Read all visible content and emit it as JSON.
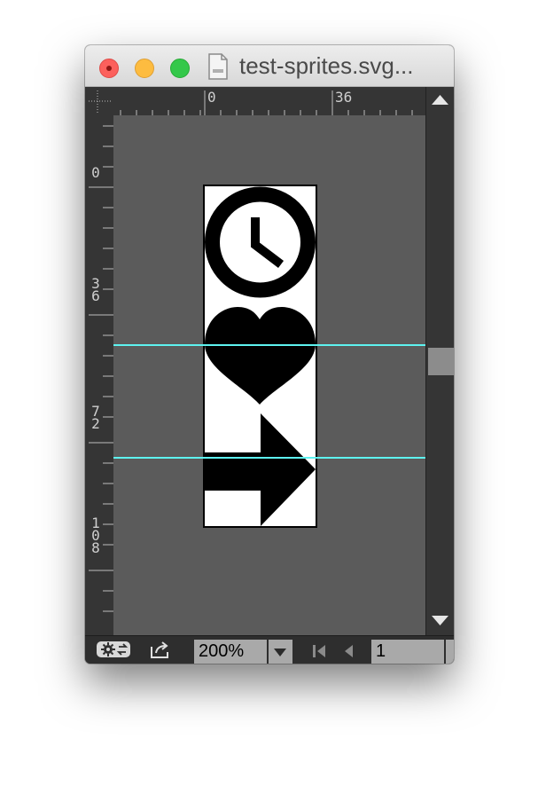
{
  "window": {
    "title": "test-sprites.svg..."
  },
  "rulers": {
    "top_labels": [
      "0",
      "36"
    ],
    "left_labels": [
      "0",
      "3\n6",
      "7\n2",
      "1\n0\n8"
    ]
  },
  "sprites": {
    "items": [
      "clock-icon",
      "heart-icon",
      "arrow-right-icon"
    ]
  },
  "status_bar": {
    "zoom_value": "200%",
    "page_value": "1"
  },
  "colors": {
    "canvas_bg": "#5b5b5b",
    "guide": "#5ef3f0",
    "ruler_bg": "#353535"
  }
}
